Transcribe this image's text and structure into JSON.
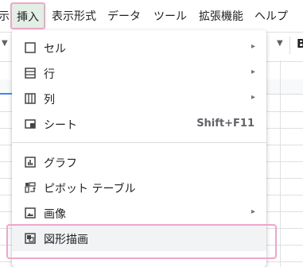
{
  "menubar": {
    "items": [
      {
        "label": "示"
      },
      {
        "label": "挿入"
      },
      {
        "label": "表示形式"
      },
      {
        "label": "データ"
      },
      {
        "label": "ツール"
      },
      {
        "label": "拡張機能"
      },
      {
        "label": "ヘルプ"
      }
    ]
  },
  "toolbar": {
    "bold_label": "B"
  },
  "insert_menu": {
    "items": [
      {
        "label": "セル",
        "icon": "cell-icon",
        "submenu": true
      },
      {
        "label": "行",
        "icon": "rows-icon",
        "submenu": true
      },
      {
        "label": "列",
        "icon": "columns-icon",
        "submenu": true
      },
      {
        "label": "シート",
        "icon": "sheet-icon",
        "shortcut": "Shift+F11"
      },
      {
        "label": "グラフ",
        "icon": "chart-icon"
      },
      {
        "label": "ピボット テーブル",
        "icon": "pivot-table-icon"
      },
      {
        "label": "画像",
        "icon": "image-icon",
        "submenu": true
      },
      {
        "label": "図形描画",
        "icon": "drawing-icon",
        "highlighted": true
      }
    ],
    "submenu_arrow": "▸"
  },
  "colors": {
    "highlight_border": "#f0a6c8",
    "active_menu_bg": "#e2efe4",
    "hover_bg": "#f1f3f4"
  }
}
